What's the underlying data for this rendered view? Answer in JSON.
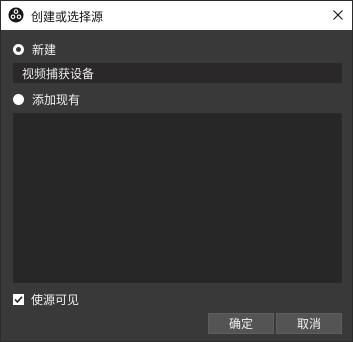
{
  "window": {
    "title": "创建或选择源",
    "app_icon": "obs-logo-icon",
    "close_icon": "close-icon"
  },
  "options": {
    "create_new_label": "新建",
    "create_new_selected": true,
    "new_source_name": "视频捕获设备",
    "add_existing_label": "添加现有",
    "add_existing_selected": false
  },
  "existing_sources": [],
  "visibility": {
    "label": "使源可见",
    "checked": true
  },
  "buttons": {
    "ok_label": "确定",
    "cancel_label": "取消"
  },
  "colors": {
    "background": "#3a393a",
    "titlebar": "#ffffff",
    "input_bg": "#2a2829",
    "list_bg": "#282728",
    "button_bg": "#555455"
  }
}
